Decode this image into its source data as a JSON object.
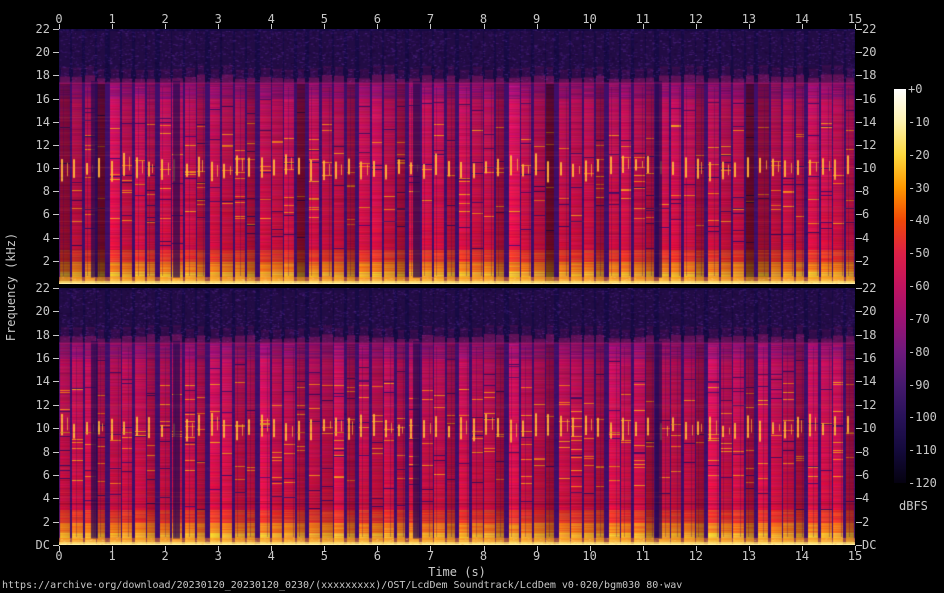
{
  "page": {
    "background": "#000000",
    "text_color": "#c8c8c8",
    "footer_url": "https://archive·org/download/20230120_20230120_0230/(xxxxxxxxx)/OST/LcdDem Soundtrack/LcdDem v0·020/bgm030 80·wav"
  },
  "chart_data": {
    "type": "heatmap",
    "subtype": "stereo-audio-spectrogram",
    "channels": 2,
    "description": "SoX-style spectrogram of a 15 s rhythmic electronic music file, two channels stacked vertically. Regular beat columns (~4 per second) span DC to a sharp lossy-encoder lowpass cutoff near 17.3 kHz; very bright bass energy below 1 kHz, bright hi-hat/harmonic dashes near 10 kHz, dark purple noise floor above the cutoff. Both channels are nearly identical.",
    "x": {
      "label": "Time (s)",
      "min": 0,
      "max": 15,
      "ticks": [
        0,
        1,
        2,
        3,
        4,
        5,
        6,
        7,
        8,
        9,
        10,
        11,
        12,
        13,
        14,
        15
      ]
    },
    "y": {
      "label": "Frequency (kHz)",
      "max": 22,
      "min_label": "DC",
      "ticks": [
        22,
        20,
        18,
        16,
        14,
        12,
        10,
        8,
        6,
        4,
        2
      ]
    },
    "colorbar": {
      "label": "dBFS",
      "max_db": 0,
      "min_db": -120,
      "ticks": [
        "+0",
        "-10",
        "-20",
        "-30",
        "-40",
        "-50",
        "-60",
        "-70",
        "-80",
        "-90",
        "-100",
        "-110",
        "-120"
      ],
      "palette": [
        {
          "db": 0,
          "color": "#ffffff"
        },
        {
          "db": -10,
          "color": "#fff3b0"
        },
        {
          "db": -20,
          "color": "#ffd940"
        },
        {
          "db": -30,
          "color": "#ff9800"
        },
        {
          "db": -40,
          "color": "#f04808"
        },
        {
          "db": -50,
          "color": "#dd2046"
        },
        {
          "db": -60,
          "color": "#c1135f"
        },
        {
          "db": -70,
          "color": "#9d1273"
        },
        {
          "db": -80,
          "color": "#6f197c"
        },
        {
          "db": -90,
          "color": "#46196f"
        },
        {
          "db": -100,
          "color": "#281259"
        },
        {
          "db": -110,
          "color": "#140a3c"
        },
        {
          "db": -120,
          "color": "#050210"
        }
      ]
    },
    "content": {
      "lowpass_cutoff_khz": 17.3,
      "bars": 16,
      "beats_per_bar": 4,
      "bar_duration_s": 0.94,
      "hat_khz": 10,
      "breaks_s": [
        0.66,
        2.2,
        6.72,
        11.28
      ],
      "colors": {
        "noise_base": "#170a43",
        "noise_speckles": [
          "#2a1263",
          "#381b76",
          "#120636",
          "#45237f"
        ],
        "gap_base": "#3f0e6a",
        "body_mid": "#d31650",
        "bass_glow": "#ff8c1e",
        "bass_bright": "#ffd966",
        "dc_line": "#fff2b0",
        "hat": "#ffb23c",
        "tip_pink": "#b81a6e"
      }
    }
  }
}
